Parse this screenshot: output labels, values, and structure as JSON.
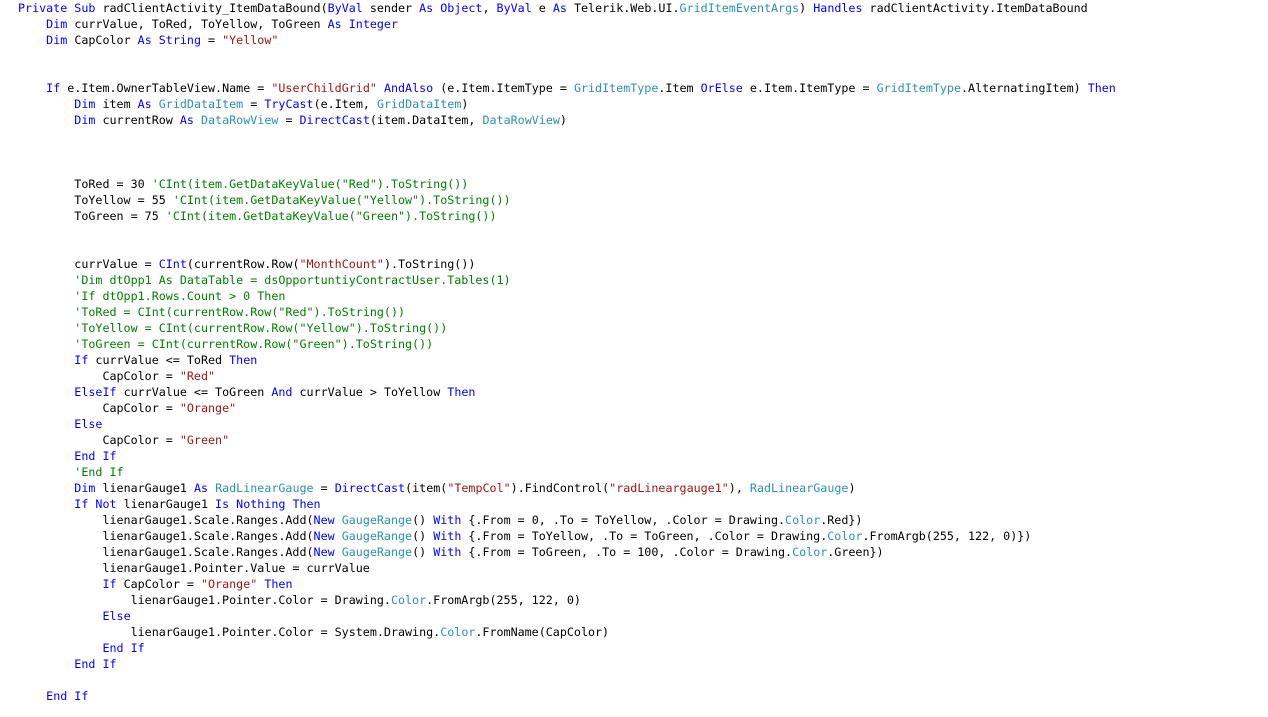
{
  "colors": {
    "keyword": "#0000ff",
    "type": "#2b91af",
    "string": "#a31515",
    "comment": "#008000",
    "text": "#000000",
    "background": "#ffffff"
  },
  "code": {
    "lines": [
      [
        [
          "kw",
          "Private Sub "
        ],
        [
          "tx",
          "radClientActivity_ItemDataBound("
        ],
        [
          "kw",
          "ByVal "
        ],
        [
          "tx",
          "sender "
        ],
        [
          "kw",
          "As Object"
        ],
        [
          "tx",
          ", "
        ],
        [
          "kw",
          "ByVal "
        ],
        [
          "tx",
          "e "
        ],
        [
          "kw",
          "As "
        ],
        [
          "tx",
          "Telerik.Web.UI."
        ],
        [
          "ty",
          "GridItemEventArgs"
        ],
        [
          "tx",
          ") "
        ],
        [
          "kw",
          "Handles "
        ],
        [
          "tx",
          "radClientActivity.ItemDataBound"
        ]
      ],
      [
        [
          "tx",
          "    "
        ],
        [
          "kw",
          "Dim "
        ],
        [
          "tx",
          "currValue, ToRed, ToYellow, ToGreen "
        ],
        [
          "kw",
          "As Integer"
        ]
      ],
      [
        [
          "tx",
          "    "
        ],
        [
          "kw",
          "Dim "
        ],
        [
          "tx",
          "CapColor "
        ],
        [
          "kw",
          "As String "
        ],
        [
          "tx",
          "= "
        ],
        [
          "st",
          "\"Yellow\""
        ]
      ],
      [],
      [],
      [
        [
          "tx",
          "    "
        ],
        [
          "kw",
          "If "
        ],
        [
          "tx",
          "e.Item.OwnerTableView.Name = "
        ],
        [
          "st",
          "\"UserChildGrid\" "
        ],
        [
          "kw",
          "AndAlso "
        ],
        [
          "tx",
          "(e.Item.ItemType = "
        ],
        [
          "ty",
          "GridItemType"
        ],
        [
          "tx",
          ".Item "
        ],
        [
          "kw",
          "OrElse "
        ],
        [
          "tx",
          "e.Item.ItemType = "
        ],
        [
          "ty",
          "GridItemType"
        ],
        [
          "tx",
          ".AlternatingItem) "
        ],
        [
          "kw",
          "Then"
        ]
      ],
      [
        [
          "tx",
          "        "
        ],
        [
          "kw",
          "Dim "
        ],
        [
          "tx",
          "item "
        ],
        [
          "kw",
          "As "
        ],
        [
          "ty",
          "GridDataItem "
        ],
        [
          "tx",
          "= "
        ],
        [
          "kw",
          "TryCast"
        ],
        [
          "tx",
          "(e.Item, "
        ],
        [
          "ty",
          "GridDataItem"
        ],
        [
          "tx",
          ")"
        ]
      ],
      [
        [
          "tx",
          "        "
        ],
        [
          "kw",
          "Dim "
        ],
        [
          "tx",
          "currentRow "
        ],
        [
          "kw",
          "As "
        ],
        [
          "ty",
          "DataRowView "
        ],
        [
          "tx",
          "= "
        ],
        [
          "kw",
          "DirectCast"
        ],
        [
          "tx",
          "(item.DataItem, "
        ],
        [
          "ty",
          "DataRowView"
        ],
        [
          "tx",
          ")"
        ]
      ],
      [],
      [],
      [],
      [
        [
          "tx",
          "        ToRed = 30 "
        ],
        [
          "cm",
          "'CInt(item.GetDataKeyValue(\"Red\").ToString())"
        ]
      ],
      [
        [
          "tx",
          "        ToYellow = 55 "
        ],
        [
          "cm",
          "'CInt(item.GetDataKeyValue(\"Yellow\").ToString())"
        ]
      ],
      [
        [
          "tx",
          "        ToGreen = 75 "
        ],
        [
          "cm",
          "'CInt(item.GetDataKeyValue(\"Green\").ToString())"
        ]
      ],
      [],
      [],
      [
        [
          "tx",
          "        currValue = "
        ],
        [
          "kw",
          "CInt"
        ],
        [
          "tx",
          "(currentRow.Row("
        ],
        [
          "st",
          "\"MonthCount\""
        ],
        [
          "tx",
          ").ToString())"
        ]
      ],
      [
        [
          "tx",
          "        "
        ],
        [
          "cm",
          "'Dim dtOpp1 As DataTable = dsOpportuntiyContractUser.Tables(1)"
        ]
      ],
      [
        [
          "tx",
          "        "
        ],
        [
          "cm",
          "'If dtOpp1.Rows.Count > 0 Then"
        ]
      ],
      [
        [
          "tx",
          "        "
        ],
        [
          "cm",
          "'ToRed = CInt(currentRow.Row(\"Red\").ToString())"
        ]
      ],
      [
        [
          "tx",
          "        "
        ],
        [
          "cm",
          "'ToYellow = CInt(currentRow.Row(\"Yellow\").ToString())"
        ]
      ],
      [
        [
          "tx",
          "        "
        ],
        [
          "cm",
          "'ToGreen = CInt(currentRow.Row(\"Green\").ToString())"
        ]
      ],
      [
        [
          "tx",
          "        "
        ],
        [
          "kw",
          "If "
        ],
        [
          "tx",
          "currValue <= ToRed "
        ],
        [
          "kw",
          "Then"
        ]
      ],
      [
        [
          "tx",
          "            CapColor = "
        ],
        [
          "st",
          "\"Red\""
        ]
      ],
      [
        [
          "tx",
          "        "
        ],
        [
          "kw",
          "ElseIf "
        ],
        [
          "tx",
          "currValue <= ToGreen "
        ],
        [
          "kw",
          "And "
        ],
        [
          "tx",
          "currValue > ToYellow "
        ],
        [
          "kw",
          "Then"
        ]
      ],
      [
        [
          "tx",
          "            CapColor = "
        ],
        [
          "st",
          "\"Orange\""
        ]
      ],
      [
        [
          "tx",
          "        "
        ],
        [
          "kw",
          "Else"
        ]
      ],
      [
        [
          "tx",
          "            CapColor = "
        ],
        [
          "st",
          "\"Green\""
        ]
      ],
      [
        [
          "tx",
          "        "
        ],
        [
          "kw",
          "End If"
        ]
      ],
      [
        [
          "tx",
          "        "
        ],
        [
          "cm",
          "'End If"
        ]
      ],
      [
        [
          "tx",
          "        "
        ],
        [
          "kw",
          "Dim "
        ],
        [
          "tx",
          "lienarGauge1 "
        ],
        [
          "kw",
          "As "
        ],
        [
          "ty",
          "RadLinearGauge "
        ],
        [
          "tx",
          "= "
        ],
        [
          "kw",
          "DirectCast"
        ],
        [
          "tx",
          "(item("
        ],
        [
          "st",
          "\"TempCol\""
        ],
        [
          "tx",
          ").FindControl("
        ],
        [
          "st",
          "\"radLineargauge1\""
        ],
        [
          "tx",
          "), "
        ],
        [
          "ty",
          "RadLinearGauge"
        ],
        [
          "tx",
          ")"
        ]
      ],
      [
        [
          "tx",
          "        "
        ],
        [
          "kw",
          "If Not "
        ],
        [
          "tx",
          "lienarGauge1 "
        ],
        [
          "kw",
          "Is Nothing Then"
        ]
      ],
      [
        [
          "tx",
          "            lienarGauge1.Scale.Ranges.Add("
        ],
        [
          "kw",
          "New "
        ],
        [
          "ty",
          "GaugeRange"
        ],
        [
          "tx",
          "() "
        ],
        [
          "kw",
          "With "
        ],
        [
          "tx",
          "{.From = 0, .To = ToYellow, .Color = Drawing."
        ],
        [
          "ty",
          "Color"
        ],
        [
          "tx",
          ".Red})"
        ]
      ],
      [
        [
          "tx",
          "            lienarGauge1.Scale.Ranges.Add("
        ],
        [
          "kw",
          "New "
        ],
        [
          "ty",
          "GaugeRange"
        ],
        [
          "tx",
          "() "
        ],
        [
          "kw",
          "With "
        ],
        [
          "tx",
          "{.From = ToYellow, .To = ToGreen, .Color = Drawing."
        ],
        [
          "ty",
          "Color"
        ],
        [
          "tx",
          ".FromArgb(255, 122, 0)})"
        ]
      ],
      [
        [
          "tx",
          "            lienarGauge1.Scale.Ranges.Add("
        ],
        [
          "kw",
          "New "
        ],
        [
          "ty",
          "GaugeRange"
        ],
        [
          "tx",
          "() "
        ],
        [
          "kw",
          "With "
        ],
        [
          "tx",
          "{.From = ToGreen, .To = 100, .Color = Drawing."
        ],
        [
          "ty",
          "Color"
        ],
        [
          "tx",
          ".Green})"
        ]
      ],
      [
        [
          "tx",
          "            lienarGauge1.Pointer.Value = currValue"
        ]
      ],
      [
        [
          "tx",
          "            "
        ],
        [
          "kw",
          "If "
        ],
        [
          "tx",
          "CapColor = "
        ],
        [
          "st",
          "\"Orange\" "
        ],
        [
          "kw",
          "Then"
        ]
      ],
      [
        [
          "tx",
          "                lienarGauge1.Pointer.Color = Drawing."
        ],
        [
          "ty",
          "Color"
        ],
        [
          "tx",
          ".FromArgb(255, 122, 0)"
        ]
      ],
      [
        [
          "tx",
          "            "
        ],
        [
          "kw",
          "Else"
        ]
      ],
      [
        [
          "tx",
          "                lienarGauge1.Pointer.Color = System.Drawing."
        ],
        [
          "ty",
          "Color"
        ],
        [
          "tx",
          ".FromName(CapColor)"
        ]
      ],
      [
        [
          "tx",
          "            "
        ],
        [
          "kw",
          "End If"
        ]
      ],
      [
        [
          "tx",
          "        "
        ],
        [
          "kw",
          "End If"
        ]
      ],
      [],
      [
        [
          "tx",
          "    "
        ],
        [
          "kw",
          "End If"
        ]
      ]
    ]
  }
}
